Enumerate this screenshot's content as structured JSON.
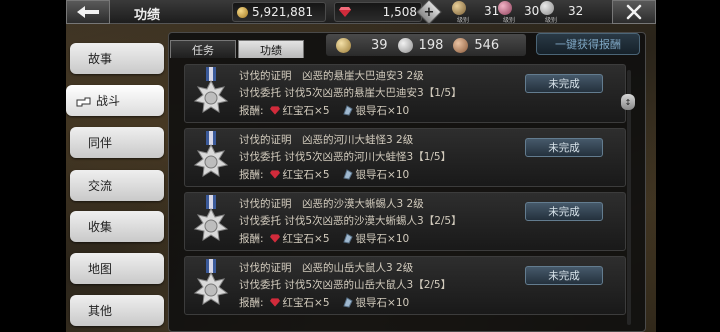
{
  "header": {
    "title": "功绩",
    "gold": "5,921,881",
    "gems": "1,508",
    "levels": [
      {
        "value": "31",
        "caption": "级别"
      },
      {
        "value": "30",
        "caption": "级别"
      },
      {
        "value": "32",
        "caption": "级别"
      }
    ]
  },
  "sidebar": {
    "items": [
      {
        "label": "故事"
      },
      {
        "label": "战斗"
      },
      {
        "label": "同伴"
      },
      {
        "label": "交流"
      },
      {
        "label": "收集"
      },
      {
        "label": "地图"
      },
      {
        "label": "其他"
      }
    ]
  },
  "tabs": {
    "missions": "任务",
    "merits": "功绩"
  },
  "medal_counts": {
    "gold": "39",
    "silver": "198",
    "bronze": "546"
  },
  "claim_all_label": "一键获得报酬",
  "rows": [
    {
      "title": "讨伐的证明　凶恶的悬崖大巴迪安3 2级",
      "desc": "讨伐委托 讨伐5次凶恶的悬崖大巴迪安3【1/5】",
      "reward_label": "报酬:",
      "reward1": "红宝石×5",
      "reward2": "银导石×10",
      "status": "未完成"
    },
    {
      "title": "讨伐的证明　凶恶的河川大蛙怪3 2级",
      "desc": "讨伐委托 讨伐5次凶恶的河川大蛙怪3【1/5】",
      "reward_label": "报酬:",
      "reward1": "红宝石×5",
      "reward2": "银导石×10",
      "status": "未完成"
    },
    {
      "title": "讨伐的证明　凶恶的沙漠大蜥蜴人3 2级",
      "desc": "讨伐委托 讨伐5次凶恶的沙漠大蜥蜴人3【2/5】",
      "reward_label": "报酬:",
      "reward1": "红宝石×5",
      "reward2": "银导石×10",
      "status": "未完成"
    },
    {
      "title": "讨伐的证明　凶恶的山岳大鼠人3 2级",
      "desc": "讨伐委托 讨伐5次凶恶的山岳大鼠人3【2/5】",
      "reward_label": "报酬:",
      "reward1": "红宝石×5",
      "reward2": "银导石×10",
      "status": "未完成"
    }
  ]
}
